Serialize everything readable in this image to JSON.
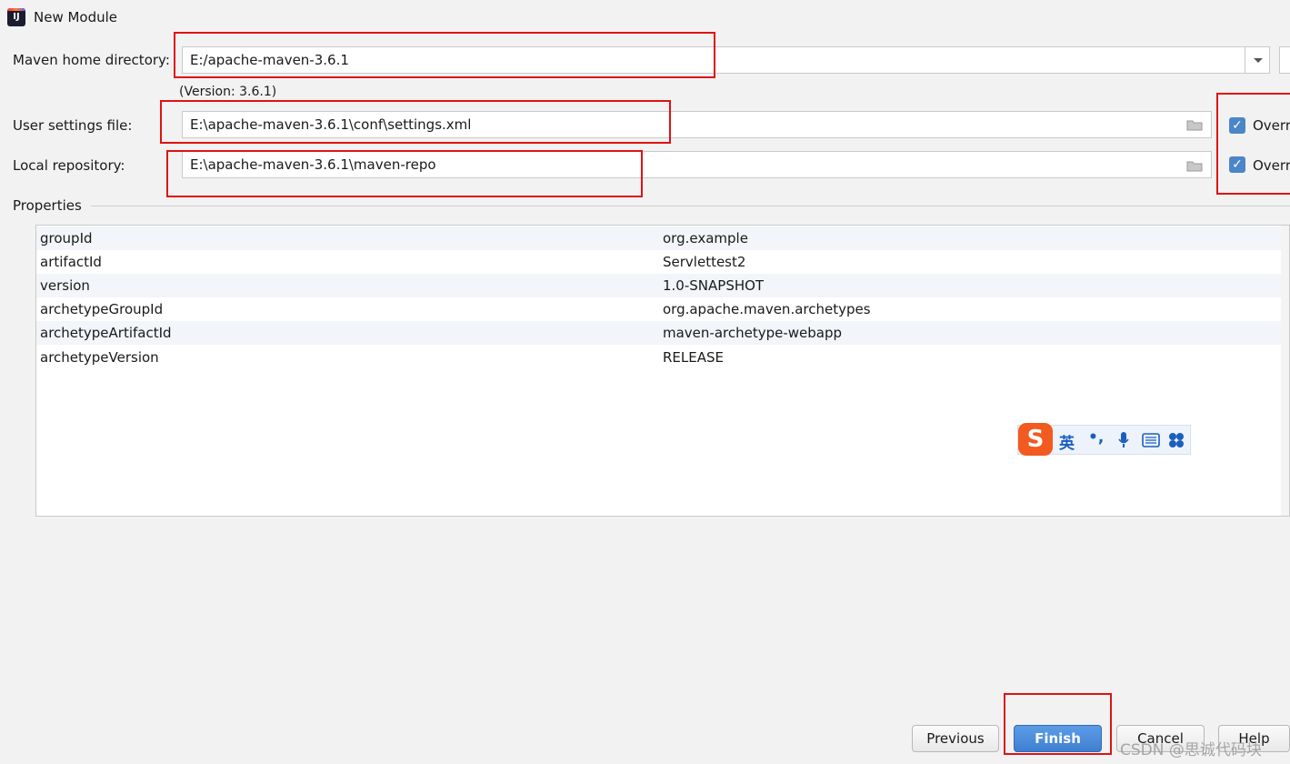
{
  "window": {
    "title": "New Module"
  },
  "maven": {
    "home_label": "Maven home directory:",
    "home_value": "E:/apache-maven-3.6.1",
    "version_text": "(Version: 3.6.1)",
    "settings_label": "User settings file:",
    "settings_value": "E:\\apache-maven-3.6.1\\conf\\settings.xml",
    "settings_override": "Overr",
    "repo_label": "Local repository:",
    "repo_value": "E:\\apache-maven-3.6.1\\maven-repo",
    "repo_override": "Overr"
  },
  "properties": {
    "section_label": "Properties",
    "rows": [
      {
        "key": "groupId",
        "value": "org.example"
      },
      {
        "key": "artifactId",
        "value": "Servlettest2"
      },
      {
        "key": "version",
        "value": "1.0-SNAPSHOT"
      },
      {
        "key": "archetypeGroupId",
        "value": "org.apache.maven.archetypes"
      },
      {
        "key": "archetypeArtifactId",
        "value": "maven-archetype-webapp"
      },
      {
        "key": "archetypeVersion",
        "value": "RELEASE"
      }
    ]
  },
  "ime": {
    "logo": "S",
    "mode": "英",
    "punct": "•,",
    "icons": [
      "microphone-icon",
      "keyboard-icon",
      "grid-menu-icon"
    ]
  },
  "buttons": {
    "previous": "Previous",
    "finish": "Finish",
    "cancel": "Cancel",
    "help": "Help"
  },
  "watermark": "CSDN @思诚代码块",
  "colors": {
    "highlight": "#e01212",
    "accent": "#4a86c8"
  }
}
